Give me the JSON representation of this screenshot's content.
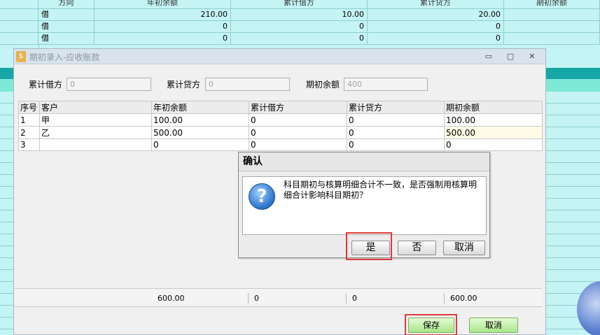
{
  "bg_table": {
    "headers": [
      "方向",
      "年初余额",
      "累计借方",
      "累计贷方",
      "期初余额"
    ],
    "rows": [
      [
        "借",
        "210.00",
        "10.00",
        "20.00",
        ""
      ],
      [
        "借",
        "0",
        "0",
        "0",
        ""
      ],
      [
        "借",
        "0",
        "0",
        "0",
        ""
      ]
    ]
  },
  "dialog": {
    "title": "期初录入-应收账款",
    "icon_glyph": "$",
    "minimize": "▭",
    "restore": "▢",
    "close": "✕",
    "fields": {
      "debit_label": "累计借方",
      "debit_value": "0",
      "credit_label": "累计贷方",
      "credit_value": "0",
      "opening_label": "期初余额",
      "opening_value": "400"
    },
    "table": {
      "headers": [
        "序号",
        "客户",
        "年初余额",
        "累计借方",
        "累计贷方",
        "期初余额"
      ],
      "rows": [
        [
          "1",
          "甲",
          "100.00",
          "0",
          "0",
          "100.00"
        ],
        [
          "2",
          "乙",
          "500.00",
          "0",
          "0",
          "500.00"
        ],
        [
          "3",
          "",
          "0",
          "0",
          "0",
          "0"
        ]
      ]
    },
    "totals": [
      "600.00",
      "0",
      "0",
      "600.00"
    ],
    "save_label": "保存",
    "cancel_label": "取消"
  },
  "confirm": {
    "title": "确认",
    "message": "科目期初与核算明细合计不一致，是否强制用核算明细合计影响科目期初？",
    "icon_glyph": "?",
    "yes_label": "是",
    "no_label": "否",
    "cancel_label": "取消"
  },
  "colors": {
    "highlight_box": "#e03a3a",
    "green_button": "#a9e58a",
    "background": "#c4f4f4"
  }
}
